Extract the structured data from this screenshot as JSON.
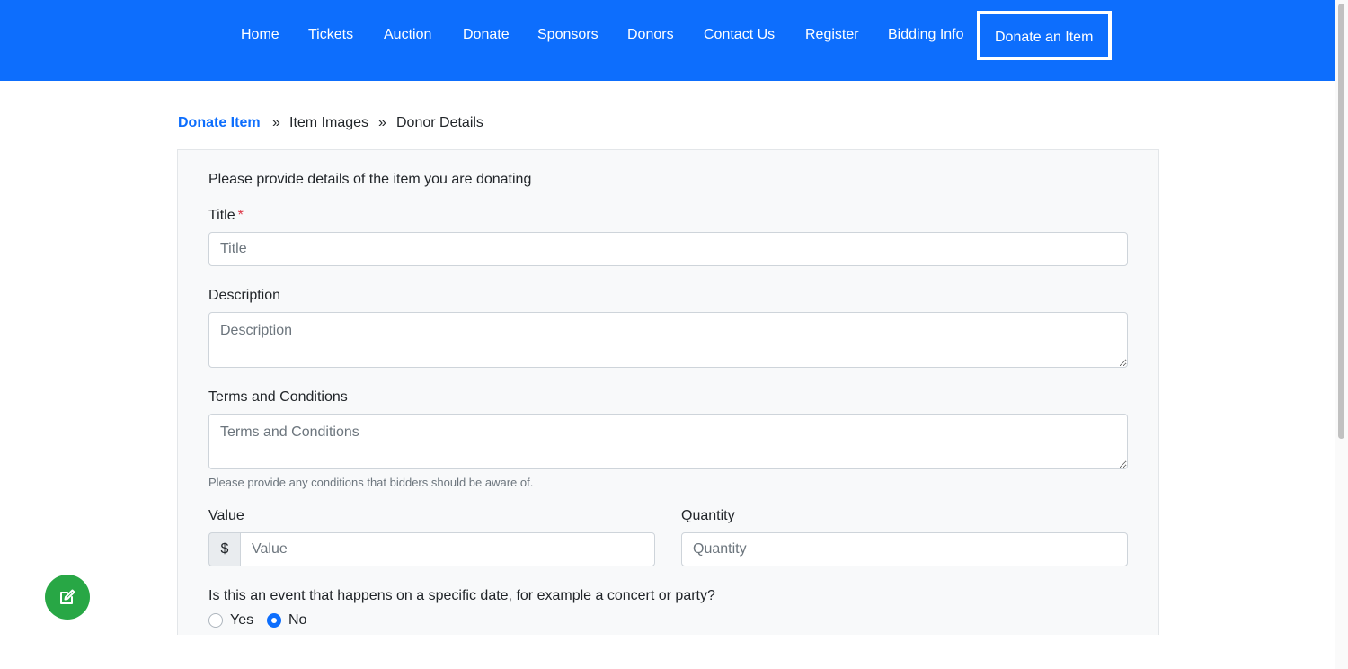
{
  "nav": {
    "items": [
      {
        "label": "Home"
      },
      {
        "label": "Tickets"
      },
      {
        "label": "Auction"
      },
      {
        "label": "Donate"
      },
      {
        "label": "Sponsors"
      },
      {
        "label": "Donors"
      },
      {
        "label": "Contact Us"
      },
      {
        "label": "Register"
      },
      {
        "label": "Bidding Info"
      },
      {
        "label": "Donate an Item"
      }
    ],
    "active": "Donate an Item"
  },
  "breadcrumb": {
    "steps": [
      "Donate Item",
      "Item Images",
      "Donor Details"
    ],
    "separator": "»"
  },
  "form": {
    "intro": "Please provide details of the item you are donating",
    "title": {
      "label": "Title",
      "required_mark": "*",
      "placeholder": "Title",
      "value": ""
    },
    "description": {
      "label": "Description",
      "placeholder": "Description",
      "value": ""
    },
    "terms": {
      "label": "Terms and Conditions",
      "placeholder": "Terms and Conditions",
      "help": "Please provide any conditions that bidders should be aware of.",
      "value": ""
    },
    "value": {
      "label": "Value",
      "prefix": "$",
      "placeholder": "Value",
      "value": ""
    },
    "quantity": {
      "label": "Quantity",
      "placeholder": "Quantity",
      "value": ""
    },
    "event_question": "Is this an event that happens on a specific date, for example a concert or party?",
    "event_options": [
      {
        "label": "Yes",
        "checked": false
      },
      {
        "label": "No",
        "checked": true
      }
    ]
  },
  "colors": {
    "primary": "#0d6efd",
    "success": "#28a745",
    "danger": "#dc3545",
    "card_bg": "#f8f9fa"
  },
  "icons": {
    "fab": "edit-icon"
  }
}
